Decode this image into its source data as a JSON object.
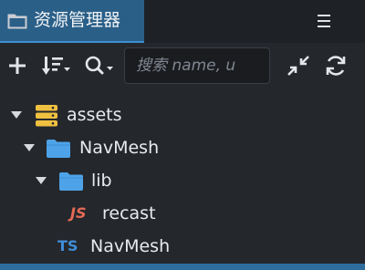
{
  "panel": {
    "title": "资源管理器",
    "icon": "folder-icon",
    "menu_icon": "hamburger-menu-icon"
  },
  "toolbar": {
    "add_icon": "plus-icon",
    "sort_icon": "sort-icon",
    "search_type_icon": "search-icon",
    "search": {
      "placeholder": "搜索 name, u",
      "value": ""
    },
    "collapse_icon": "collapse-all-icon",
    "refresh_icon": "refresh-icon"
  },
  "tree": [
    {
      "label": "assets",
      "kind": "database",
      "icon": "database-icon",
      "depth": 0,
      "expanded": true
    },
    {
      "label": "NavMesh",
      "kind": "folder",
      "icon": "folder-icon",
      "depth": 1,
      "expanded": true
    },
    {
      "label": "lib",
      "kind": "folder",
      "icon": "folder-icon",
      "depth": 2,
      "expanded": true
    },
    {
      "label": "recast",
      "kind": "javascript",
      "badge": "JS",
      "depth": 3
    },
    {
      "label": "NavMesh",
      "kind": "typescript",
      "badge": "TS",
      "depth": 2
    }
  ],
  "colors": {
    "accent": "#2a5f88",
    "folder": "#4ea3e8",
    "database": "#f0c040",
    "js": "#e56a55",
    "ts": "#3f8ed8"
  }
}
